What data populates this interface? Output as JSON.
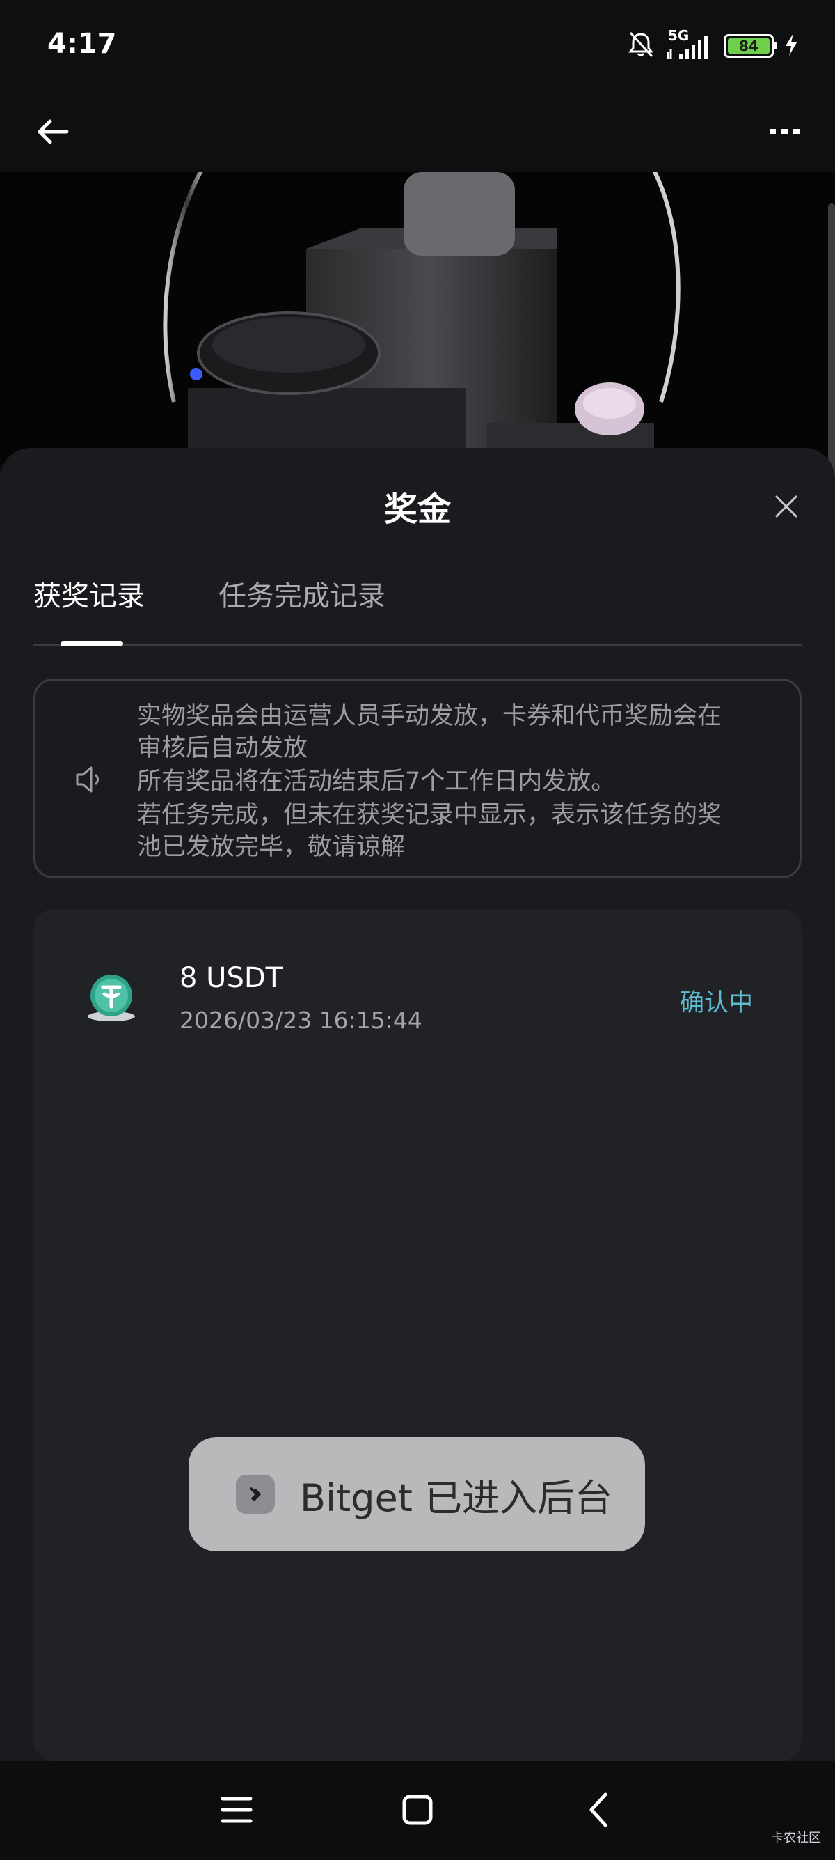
{
  "status_bar": {
    "time": "4:17",
    "network": "5G",
    "battery": "84"
  },
  "nav": {
    "back_icon": "arrow-left-icon",
    "more_icon": "more-icon"
  },
  "sheet": {
    "title": "奖金",
    "tabs": [
      {
        "label": "获奖记录",
        "active": true
      },
      {
        "label": "任务完成记录",
        "active": false
      }
    ],
    "notice": {
      "lines": [
        "实物奖品会由运营人员手动发放，卡券和代币奖励会在\n审核后自动发放",
        "所有奖品将在活动结束后7个工作日内发放。",
        "若任务完成，但未在获奖记录中显示，表示该任务的奖\n池已发放完毕，敬请谅解"
      ]
    },
    "rewards": [
      {
        "amount": "8 USDT",
        "time": "2026/03/23 16:15:44",
        "status": "确认中"
      }
    ]
  },
  "toast": {
    "text": "Bitget 已进入后台"
  },
  "watermark": "卡农社区",
  "colors": {
    "accent_status": "#5dbcd2",
    "battery_fill": "#6fcf4a",
    "sheet_bg": "#1a1b1e"
  }
}
